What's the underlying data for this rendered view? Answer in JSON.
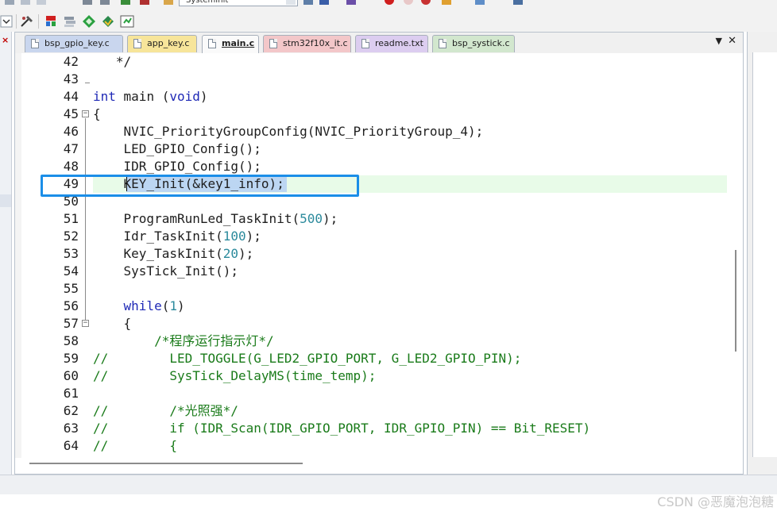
{
  "toolbar": {
    "function_combo_value": "SystemInit"
  },
  "tabs": [
    {
      "label": "bsp_gpio_key.c",
      "color": "#c9d6ee",
      "active": false
    },
    {
      "label": "app_key.c",
      "color": "#f7e59a",
      "active": false
    },
    {
      "label": "main.c",
      "color": "#fafafa",
      "active": true
    },
    {
      "label": "stm32f10x_it.c",
      "color": "#f3c7c9",
      "active": false
    },
    {
      "label": "readme.txt",
      "color": "#dccdf0",
      "active": false
    },
    {
      "label": "bsp_systick.c",
      "color": "#d2e7ce",
      "active": false
    }
  ],
  "tab_menu_glyph": "▼",
  "tab_close_glyph": "✕",
  "lines": [
    {
      "n": "42",
      "text": "   */"
    },
    {
      "n": "43",
      "text": ""
    },
    {
      "n": "44",
      "text": "int main (void)"
    },
    {
      "n": "45",
      "text": "{"
    },
    {
      "n": "46",
      "text": "    NVIC_PriorityGroupConfig(NVIC_PriorityGroup_4);"
    },
    {
      "n": "47",
      "text": "    LED_GPIO_Config();"
    },
    {
      "n": "48",
      "text": "    IDR_GPIO_Config();"
    },
    {
      "n": "49",
      "text": "    KEY_Init(&key1_info);"
    },
    {
      "n": "50",
      "text": ""
    },
    {
      "n": "51",
      "text": "    ProgramRunLed_TaskInit(500);"
    },
    {
      "n": "52",
      "text": "    Idr_TaskInit(100);"
    },
    {
      "n": "53",
      "text": "    Key_TaskInit(20);"
    },
    {
      "n": "54",
      "text": "    SysTick_Init();"
    },
    {
      "n": "55",
      "text": ""
    },
    {
      "n": "56",
      "text": "    while(1)"
    },
    {
      "n": "57",
      "text": "    {"
    },
    {
      "n": "58",
      "text": "        /*程序运行指示灯*/"
    },
    {
      "n": "59",
      "text": "//        LED_TOGGLE(G_LED2_GPIO_PORT, G_LED2_GPIO_PIN);"
    },
    {
      "n": "60",
      "text": "//        SysTick_DelayMS(time_temp);"
    },
    {
      "n": "61",
      "text": ""
    },
    {
      "n": "62",
      "text": "//        /*光照强*/"
    },
    {
      "n": "63",
      "text": "//        if (IDR_Scan(IDR_GPIO_PORT, IDR_GPIO_PIN) == Bit_RESET)"
    },
    {
      "n": "64",
      "text": "//        {"
    }
  ],
  "colors": {
    "keyword": "#1f29b6",
    "number": "#2b8a9c",
    "comment": "#1a7b1a",
    "highlight_box": "#1b8ee8",
    "selection": "#bcd6f2",
    "current_line": "#e8fbe8"
  },
  "watermark": "CSDN @恶魔泡泡糖"
}
